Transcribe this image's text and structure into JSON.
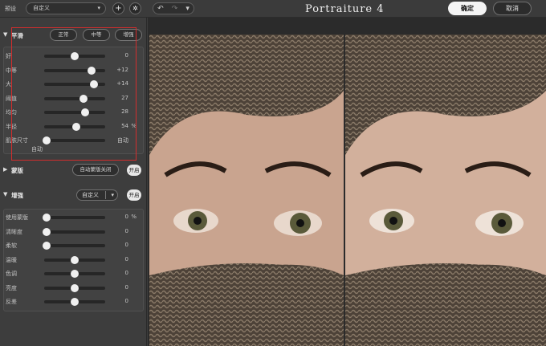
{
  "toolbar": {
    "preset_label": "预设",
    "preset_value": "自定义",
    "add_icon": "plus-icon",
    "settings_icon": "gear-icon",
    "undo_icon": "undo-icon",
    "redo_icon": "redo-icon",
    "history_icon": "chevron-down-icon",
    "app_title": "Portraiture 4",
    "confirm_label": "确定",
    "cancel_label": "取消"
  },
  "smoothing": {
    "title": "平滑",
    "pills": [
      "正常",
      "中等",
      "增强"
    ],
    "sliders": [
      {
        "label": "好",
        "value": 0,
        "display": "0",
        "unit": "",
        "fraction": 0.5
      },
      {
        "label": "中等",
        "value": 12,
        "display": "+12",
        "unit": "",
        "fraction": 0.78
      },
      {
        "label": "大",
        "value": 14,
        "display": "+14",
        "unit": "",
        "fraction": 0.82
      },
      {
        "label": "阈值",
        "value": 27,
        "display": "27",
        "unit": "",
        "fraction": 0.64
      },
      {
        "label": "均匀",
        "value": 28,
        "display": "28",
        "unit": "",
        "fraction": 0.67
      },
      {
        "label": "半径",
        "value": 54,
        "display": "54",
        "unit": "%",
        "fraction": 0.52
      },
      {
        "label": "肌肤尺寸",
        "value": 0,
        "display": "自动",
        "unit": "",
        "fraction": 0.04
      }
    ],
    "auto_label": "自动"
  },
  "mask": {
    "title": "蒙版",
    "auto_mask_label": "自动蒙版关闭",
    "toggle_label": "开启"
  },
  "enhance": {
    "title": "增强",
    "tint_value": "自定义",
    "toggle_label": "开启",
    "sliders": [
      {
        "label": "使用蒙版",
        "value": 0,
        "display": "0",
        "unit": "%",
        "fraction": 0.04
      },
      {
        "label": "清晰度",
        "value": 0,
        "display": "0",
        "unit": "",
        "fraction": 0.04
      },
      {
        "label": "柔软",
        "value": 0,
        "display": "0",
        "unit": "",
        "fraction": 0.04
      },
      {
        "label": "温暖",
        "value": 0,
        "display": "0",
        "unit": "",
        "fraction": 0.5
      },
      {
        "label": "色调",
        "value": 0,
        "display": "0",
        "unit": "",
        "fraction": 0.5
      },
      {
        "label": "亮度",
        "value": 0,
        "display": "0",
        "unit": "",
        "fraction": 0.5
      },
      {
        "label": "反差",
        "value": 0,
        "display": "0",
        "unit": "",
        "fraction": 0.5
      }
    ]
  },
  "colors": {
    "panel_bg": "#3d3d3d",
    "highlight": "#d22d2d",
    "button_light": "#f4f4f4"
  }
}
